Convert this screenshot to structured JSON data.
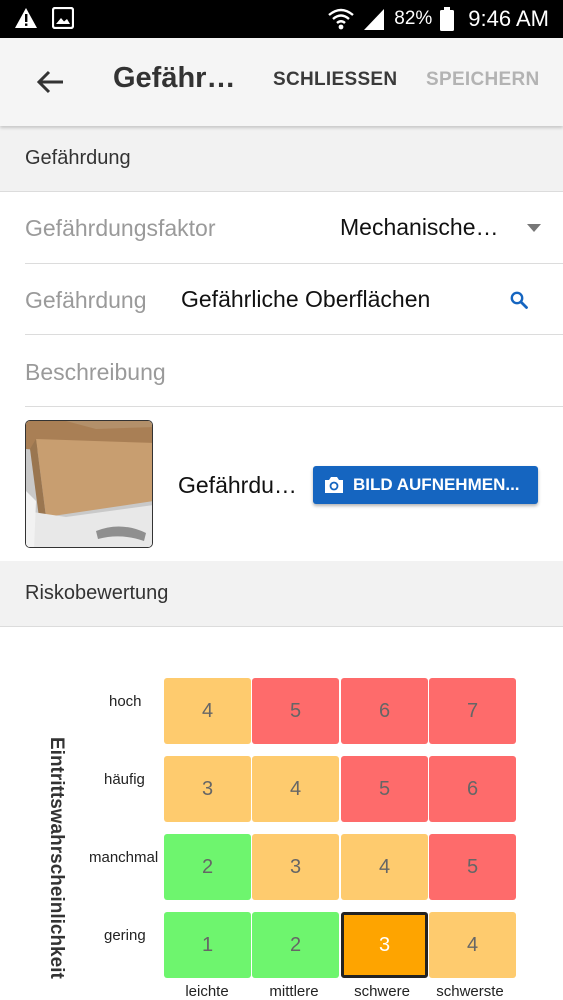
{
  "status_bar": {
    "icons": [
      "warning-icon",
      "image-icon",
      "wifi-icon",
      "signal-icon",
      "battery-icon"
    ],
    "battery": "82%",
    "time": "9:46 AM"
  },
  "app_bar": {
    "title": "Gefährliche Oberflächen",
    "close_label": "SCHLIESSEN",
    "save_label": "SPEICHERN"
  },
  "section_hazard": {
    "title": "Gefährdung"
  },
  "form": {
    "factor": {
      "label": "Gefährdungsfaktor",
      "value": "Mechanische Gefährdung"
    },
    "hazard": {
      "label": "Gefährdung",
      "value": "Gefährliche Oberflächen"
    },
    "description": {
      "label": "Beschreibung"
    }
  },
  "photo": {
    "caption": "Gefährdungsbild",
    "button_label": "BILD AUFNEHMEN..."
  },
  "section_risk": {
    "title": "Riskobewertung"
  },
  "risk_matrix": {
    "y_axis_label": "Eintrittswahrscheinlichkeit",
    "rows": [
      {
        "label": "hoch",
        "values": [
          "4",
          "5",
          "6",
          "7"
        ]
      },
      {
        "label": "häufig",
        "values": [
          "3",
          "4",
          "5",
          "6"
        ]
      },
      {
        "label": "manchmal",
        "values": [
          "2",
          "3",
          "4",
          "5"
        ]
      },
      {
        "label": "gering",
        "values": [
          "1",
          "2",
          "3",
          "4"
        ]
      }
    ],
    "columns": [
      "leichte",
      "mittlere",
      "schwere",
      "schwerste"
    ],
    "selected": {
      "row": 3,
      "col": 2
    },
    "colors": {
      "green": "#6ef56e",
      "yellow": "#fecb6e",
      "red": "#fe6b6b",
      "selected": "#fea400"
    }
  }
}
